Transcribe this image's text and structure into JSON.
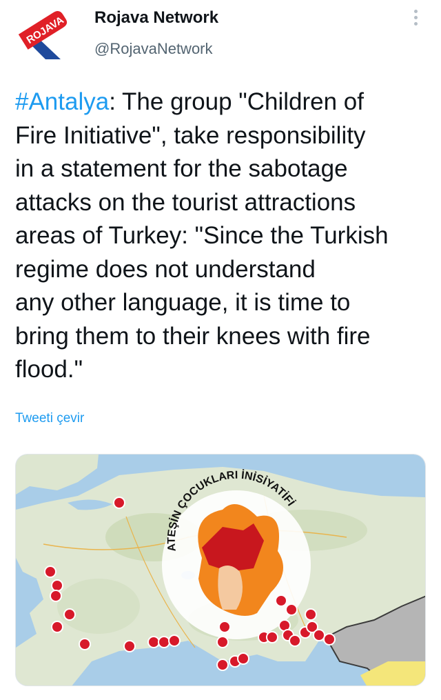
{
  "account": {
    "display_name": "Rojava Network",
    "handle": "@RojavaNetwork",
    "avatar_text": "ROJAVA"
  },
  "tweet": {
    "hashtag": "#Antalya",
    "lines": [
      ": The group \"Children of",
      "Fire Initiative\", take responsibility",
      "in a statement for the sabotage",
      "attacks on the tourist attractions",
      "areas of Turkey: \"Since the Turkish",
      "regime does not understand",
      "any other language, it is time to",
      "bring them to their knees with fire",
      "flood.\""
    ],
    "translate_label": "Tweeti çevir"
  },
  "media": {
    "type": "map",
    "logo_text": "ATEŞİN ÇOCUKLARI İNİSİYATİFİ",
    "icon": "map-with-fire-markers",
    "colors": {
      "sea": "#a9cde8",
      "land": "#dfe7d2",
      "marker": "#d7192a",
      "fire": "#f2861d"
    }
  },
  "colors": {
    "accent": "#1d9bf0",
    "text": "#0f1419",
    "muted": "#536471"
  }
}
